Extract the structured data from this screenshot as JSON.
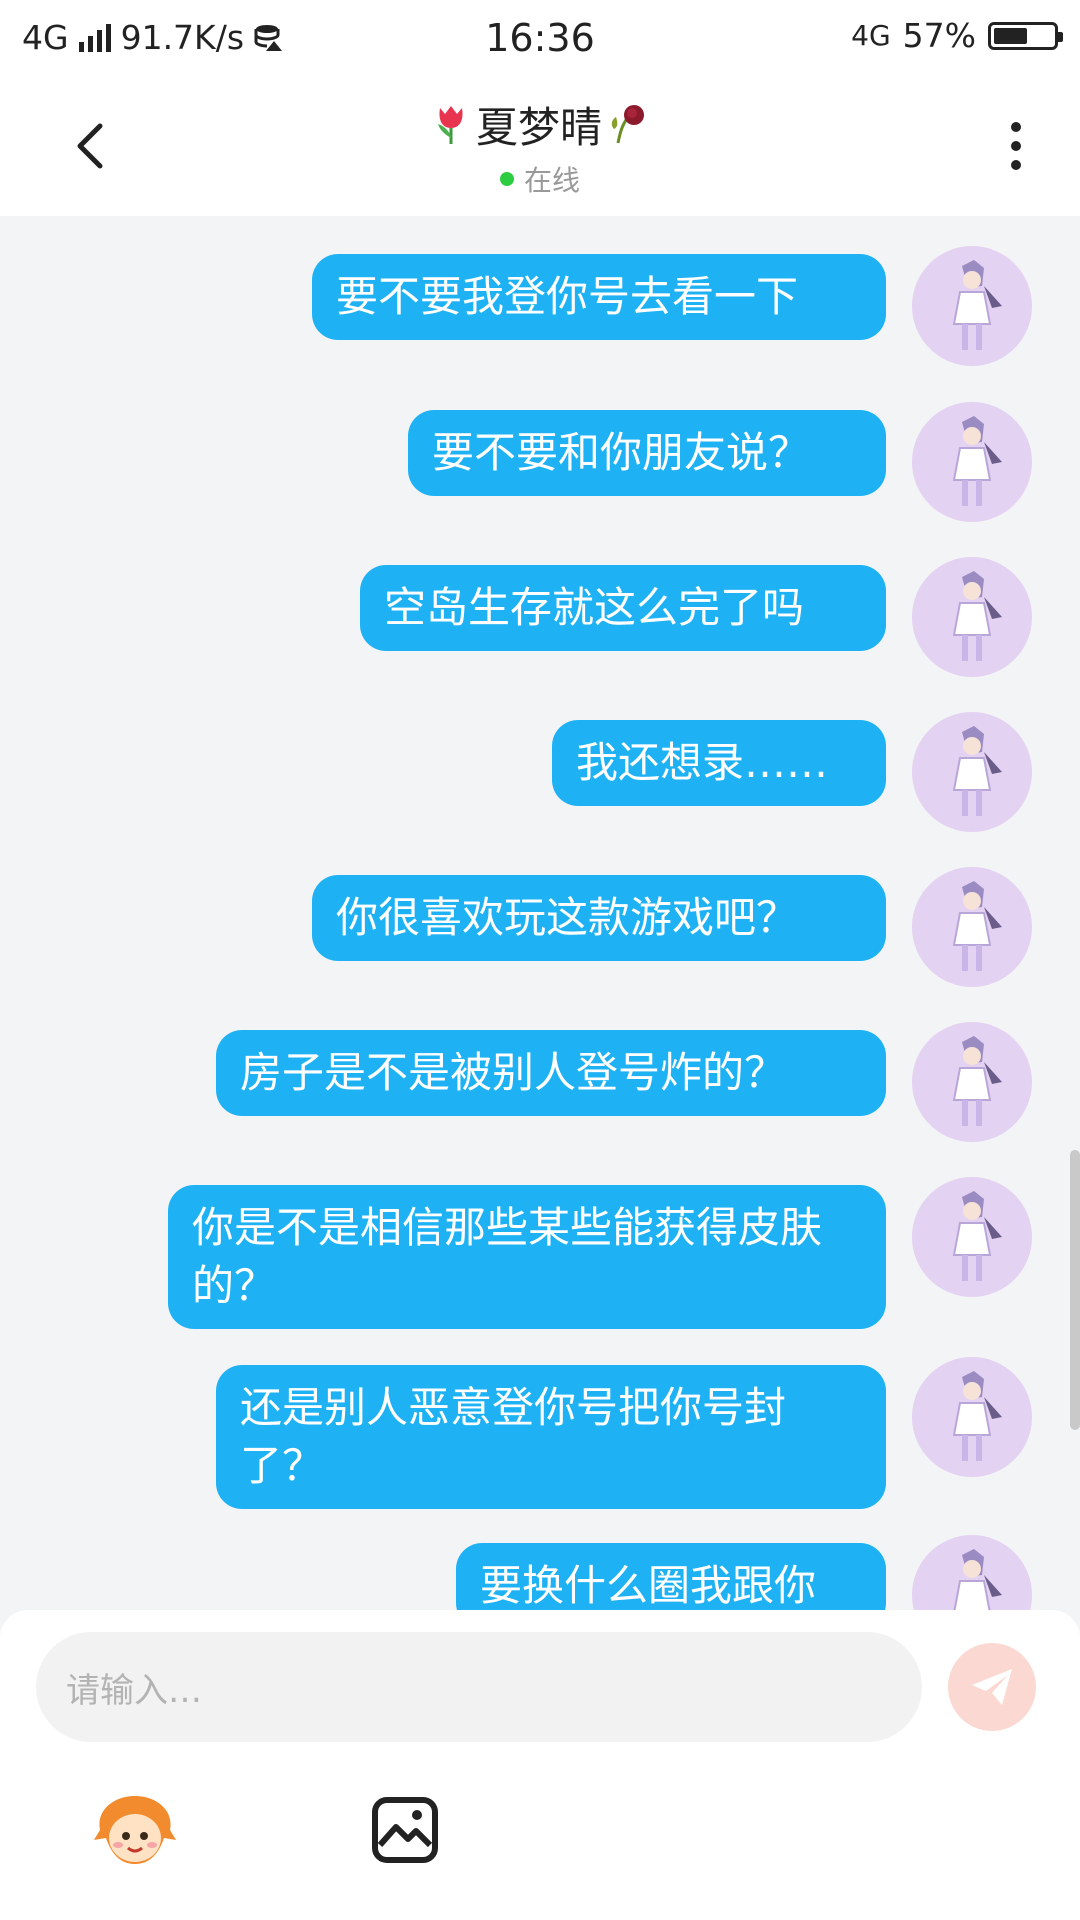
{
  "status_bar": {
    "network_left": "4G",
    "speed": "91.7K/s",
    "time": "16:36",
    "network_right": "4G",
    "battery": "57%",
    "battery_level": 0.57
  },
  "header": {
    "title": "夏梦晴",
    "status": "在线"
  },
  "messages": [
    {
      "text": "要不要我登你号去看一下"
    },
    {
      "text": "要不要和你朋友说？"
    },
    {
      "text": "空岛生存就这么完了吗"
    },
    {
      "text": "我还想录……"
    },
    {
      "text": "你很喜欢玩这款游戏吧？"
    },
    {
      "text": "房子是不是被别人登号炸的？"
    },
    {
      "text": "你是不是相信那些某些能获得皮肤的？"
    },
    {
      "text": "还是别人恶意登你号把你号封了？"
    },
    {
      "text": "要换什么圈我跟你"
    }
  ],
  "input": {
    "placeholder": "请输入…"
  },
  "colors": {
    "bubble": "#1eb2f4",
    "send_button": "#fbd9d2",
    "online_dot": "#2ecc40"
  }
}
